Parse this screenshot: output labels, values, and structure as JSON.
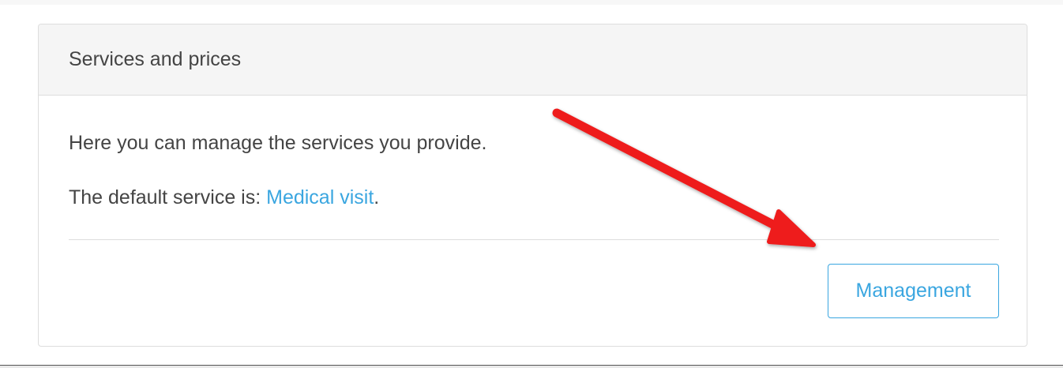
{
  "panel": {
    "title": "Services and prices",
    "description": "Here you can manage the services you provide.",
    "default_service_prefix": "The default service is: ",
    "default_service_link": "Medical visit",
    "default_service_suffix": ".",
    "management_button_label": "Management"
  },
  "annotation": {
    "arrow_color": "#ee1c1c"
  },
  "colors": {
    "link": "#3aa6e0",
    "text": "#444444",
    "heading_bg": "#f5f5f5",
    "border": "#dddddd"
  }
}
